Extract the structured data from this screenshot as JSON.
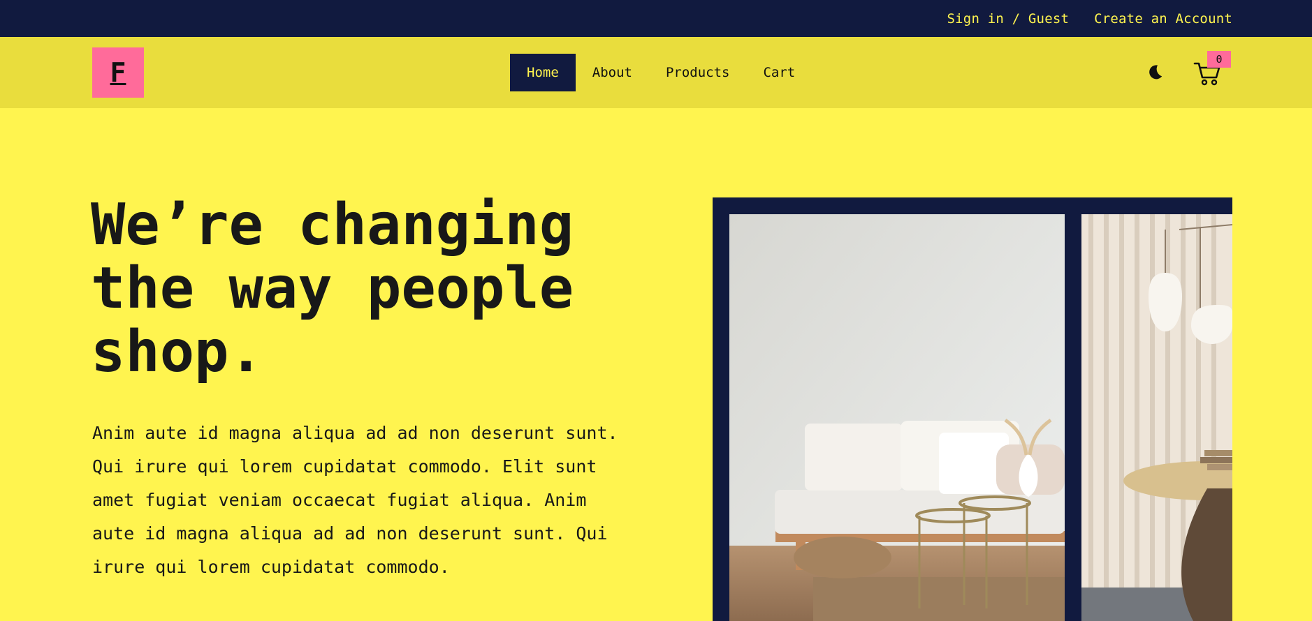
{
  "topbar": {
    "sign_in": "Sign in / Guest",
    "create_account": "Create an Account"
  },
  "navbar": {
    "logo_letter": "F",
    "links": [
      "Home",
      "About",
      "Products",
      "Cart"
    ],
    "active_link": "Home",
    "theme_icon": "moon-icon",
    "cart_icon": "cart-icon",
    "cart_count": "0"
  },
  "hero": {
    "title": "We’re changing the way people shop.",
    "body": "Anim aute id magna aliqua ad ad non deserunt sunt. Qui irure qui lorem cupidatat commodo. Elit sunt amet fugiat veniam occaecat fugiat aliqua. Anim aute id magna aliqua ad ad non deserunt sunt. Qui irure qui lorem cupidatat commodo."
  },
  "colors": {
    "page_bg": "#fff44f",
    "nav_bg": "#e9dd3d",
    "dark": "#111a3f",
    "accent_pink": "#ff6b9a"
  }
}
